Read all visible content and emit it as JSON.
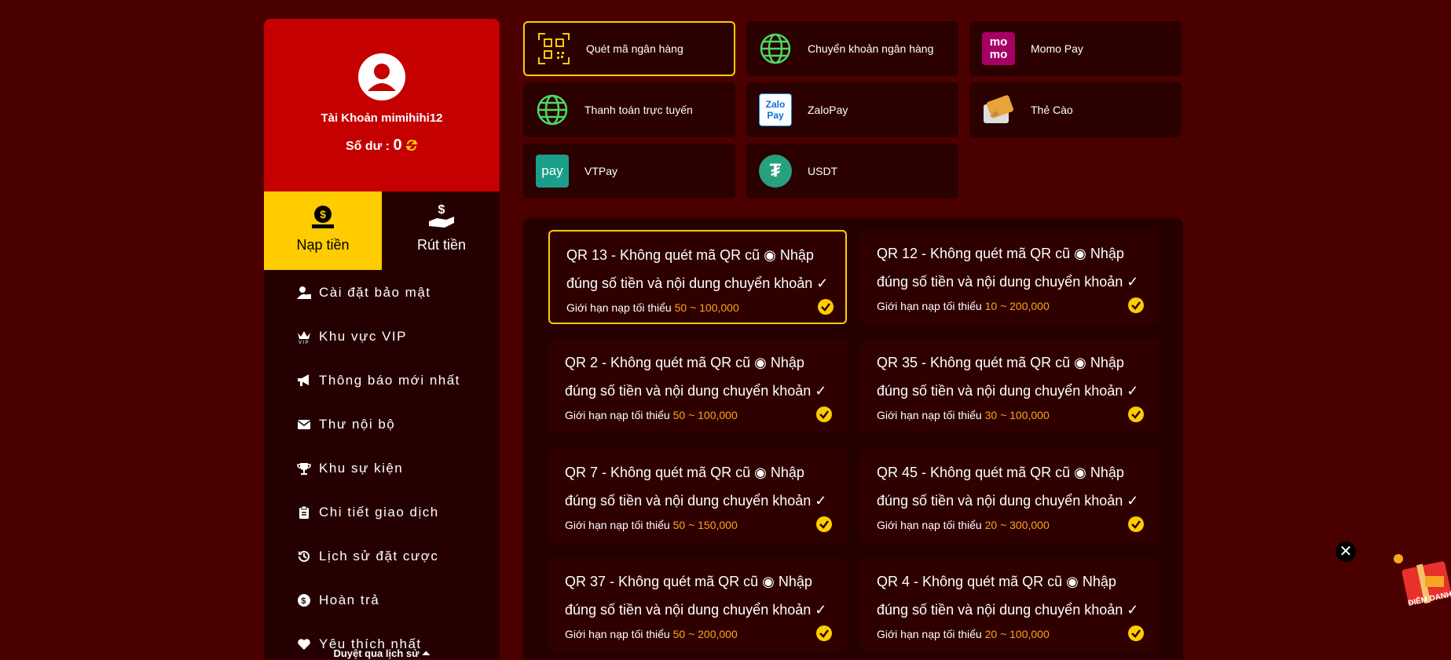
{
  "profile": {
    "account_prefix": "Tài Khoản",
    "username": "mimihihi12",
    "balance_label": "Số dư :",
    "balance": "0"
  },
  "tabs": [
    {
      "label": "Nạp tiền"
    },
    {
      "label": "Rút tiền"
    }
  ],
  "menu": [
    "Cài đặt bảo mật",
    "Khu vực VIP",
    "Thông báo mới nhất",
    "Thư nội bộ",
    "Khu sự kiện",
    "Chi tiết giao dịch",
    "Lịch sử đặt cược",
    "Hoàn trả",
    "Yêu thích nhất"
  ],
  "history_link": "Duyệt qua lịch sử ⏶",
  "payment_methods": [
    {
      "label": "Quét mã ngân hàng",
      "icon": "qr-scan-icon"
    },
    {
      "label": "Chuyển khoản ngân hàng",
      "icon": "globe-icon"
    },
    {
      "label": "Momo Pay",
      "icon": "momo-logo",
      "logo_text": "mo mo"
    },
    {
      "label": "Thanh toán trực tuyến",
      "icon": "globe-icon"
    },
    {
      "label": "ZaloPay",
      "icon": "zalopay-logo",
      "logo_text": "Zalo Pay"
    },
    {
      "label": "Thẻ Cào",
      "icon": "scratch-card-icon"
    },
    {
      "label": "VTPay",
      "icon": "vtpay-logo",
      "logo_text": "pay"
    },
    {
      "label": "USDT",
      "icon": "tether-logo",
      "logo_text": "₮"
    }
  ],
  "qr_channels": [
    {
      "name": "QR 13",
      "note": "Không quét mã QR cũ ◉ Nhập đúng số tiền và nội dung chuyển khoản ✓",
      "range": "50 ~ 100,000"
    },
    {
      "name": "QR 12",
      "note": "Không quét mã QR cũ ◉ Nhập đúng số tiền và nội dung chuyển khoản ✓",
      "range": "10 ~ 200,000"
    },
    {
      "name": "QR 2",
      "note": "Không quét mã QR cũ ◉ Nhập đúng số tiền và nội dung chuyển khoản ✓",
      "range": "50 ~ 100,000"
    },
    {
      "name": "QR 35",
      "note": "Không quét mã QR cũ ◉ Nhập đúng số tiền và nội dung chuyển khoản ✓",
      "range": "30 ~ 100,000"
    },
    {
      "name": "QR 7",
      "note": "Không quét mã QR cũ ◉ Nhập đúng số tiền và nội dung chuyển khoản ✓",
      "range": "50 ~ 150,000"
    },
    {
      "name": "QR 45",
      "note": "Không quét mã QR cũ ◉ Nhập đúng số tiền và nội dung chuyển khoản ✓",
      "range": "20 ~ 300,000"
    },
    {
      "name": "QR 37",
      "note": "Không quét mã QR cũ ◉ Nhập đúng số tiền và nội dung chuyển khoản ✓",
      "range": "50 ~ 200,000"
    },
    {
      "name": "QR 4",
      "note": "Không quét mã QR cũ ◉ Nhập đúng số tiền và nội dung chuyển khoản ✓",
      "range": "20 ~ 100,000"
    }
  ],
  "limit_label": "Giới hạn nạp tối thiểu",
  "widgets": {
    "close_symbol": "✕",
    "gift_label": "ĐIỂM DANH"
  },
  "colors": {
    "accent": "#ffcc00",
    "profile_bg": "#c40000",
    "page_bg": "#4b0000",
    "range_text": "#ffa31a"
  }
}
